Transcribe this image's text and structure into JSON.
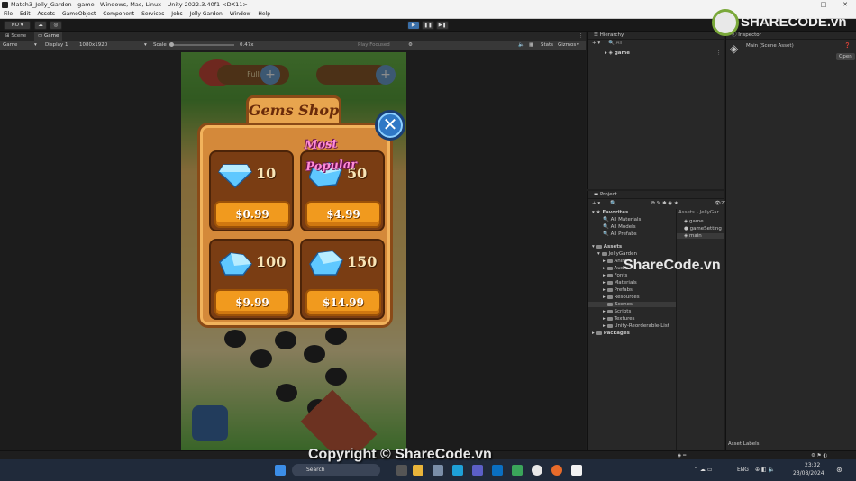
{
  "window": {
    "title": "Match3_Jelly_Garden - game - Windows, Mac, Linux - Unity 2022.3.40f1 <DX11>",
    "min": "–",
    "max": "□",
    "close": "✕"
  },
  "menu": [
    "File",
    "Edit",
    "Assets",
    "GameObject",
    "Component",
    "Services",
    "Jobs",
    "Jelly Garden",
    "Window",
    "Help"
  ],
  "toolbar": {
    "account": "NO",
    "play": "▶",
    "pause": "❚❚",
    "step": "▶❚"
  },
  "game_view": {
    "tabs": [
      "Scene",
      "Game"
    ],
    "game_label": "Game",
    "display": "Display 1",
    "resolution": "1080x1920",
    "scale_label": "Scale",
    "scale_value": "0.47x",
    "play_mode": "Play Focused",
    "stats": "Stats",
    "gizmos": "Gizmos"
  },
  "hud": {
    "full": "Full"
  },
  "shop": {
    "title": "Gems Shop",
    "badge": "Most Popular",
    "close": "✕",
    "packs": [
      {
        "amount": "10",
        "price": "$0.99"
      },
      {
        "amount": "50",
        "price": "$4.99"
      },
      {
        "amount": "100",
        "price": "$9.99"
      },
      {
        "amount": "150",
        "price": "$14.99"
      }
    ]
  },
  "hierarchy": {
    "title": "Hierarchy",
    "search": "All",
    "root": "game"
  },
  "project": {
    "title": "Project",
    "count": "21",
    "favorites": "Favorites",
    "fav_items": [
      "All Materials",
      "All Models",
      "All Prefabs"
    ],
    "assets": "Assets",
    "jelly": "JellyGarden",
    "folders": [
      "Anim",
      "Audio",
      "Fonts",
      "Materials",
      "Prefabs",
      "Resources",
      "Scenes",
      "Scripts",
      "Textures",
      "Unity-Reorderable-List"
    ],
    "packages": "Packages",
    "breadcrumb": "Assets › JellyGar",
    "files": [
      "game",
      "gameSetting",
      "main"
    ]
  },
  "inspector": {
    "title": "Inspector",
    "object": "Main (Scene Asset)",
    "open": "Open"
  },
  "status": {
    "asset_labels": "Asset Labels"
  },
  "taskbar": {
    "search": "Search",
    "lang": "ENG",
    "time": "23:32",
    "date": "23/08/2024"
  },
  "watermark": {
    "logo": "SHARECODE.vn",
    "center": "ShareCode.vn",
    "copyright": "Copyright © ShareCode.vn"
  }
}
